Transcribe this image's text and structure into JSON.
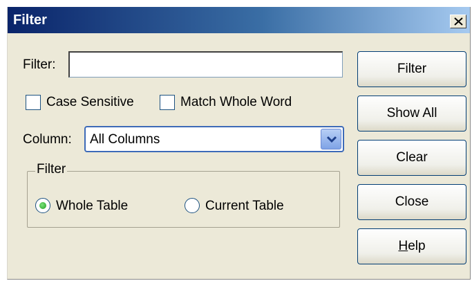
{
  "window": {
    "title": "Filter",
    "close_glyph": "×"
  },
  "filter_field": {
    "label": "Filter:",
    "value": ""
  },
  "options": {
    "case_sensitive": {
      "label": "Case Sensitive",
      "checked": false
    },
    "match_whole_word": {
      "label": "Match Whole Word",
      "checked": false
    }
  },
  "column": {
    "label": "Column:",
    "selected": "All Columns"
  },
  "scope_group": {
    "legend": "Filter",
    "whole_table": {
      "label": "Whole Table",
      "selected": true
    },
    "current_table": {
      "label": "Current Table",
      "selected": false
    }
  },
  "buttons": {
    "filter": "Filter",
    "show_all": "Show All",
    "clear": "Clear",
    "close": "Close",
    "help_mnemonic": "H",
    "help_rest": "elp"
  },
  "icons": {
    "close": "close-icon",
    "dropdown": "chevron-down-icon",
    "radio_selected": "radio-selected-icon"
  },
  "colors": {
    "title_gradient_start": "#0a246a",
    "title_gradient_end": "#a6caf0",
    "dialog_bg": "#ece9d8",
    "radio_dot": "#1f9d1f"
  }
}
